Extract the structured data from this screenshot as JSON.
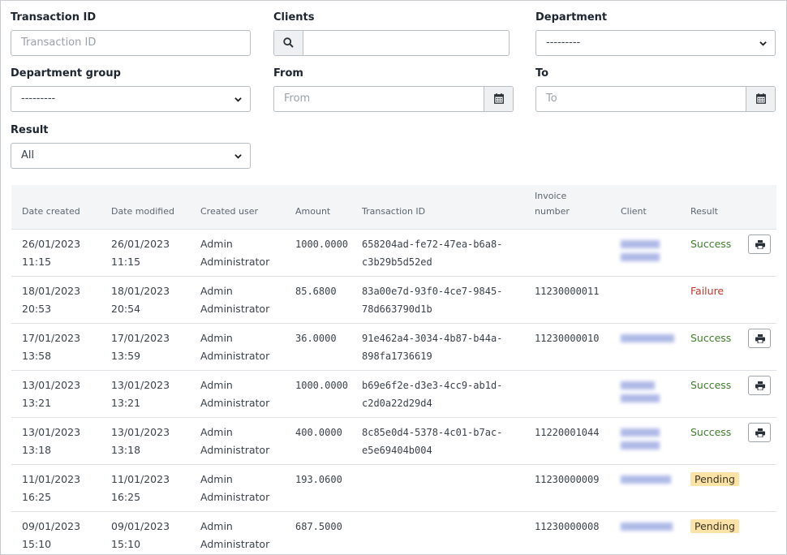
{
  "filters": {
    "transaction_id": {
      "label": "Transaction ID",
      "placeholder": "Transaction ID"
    },
    "clients": {
      "label": "Clients",
      "value": ""
    },
    "department": {
      "label": "Department",
      "selected": "---------"
    },
    "department_group": {
      "label": "Department group",
      "selected": "---------"
    },
    "from": {
      "label": "From",
      "placeholder": "From"
    },
    "to": {
      "label": "To",
      "placeholder": "To"
    },
    "result": {
      "label": "Result",
      "selected": "All"
    }
  },
  "table": {
    "headers": [
      "Date created",
      "Date modified",
      "Created user",
      "Amount",
      "Transaction ID",
      "Invoice number",
      "Client",
      "Result",
      ""
    ],
    "rows": [
      {
        "created_date": "26/01/2023",
        "created_time": "11:15",
        "modified_date": "26/01/2023",
        "modified_time": "11:15",
        "user_first": "Admin",
        "user_last": "Administrator",
        "amount": "1000.0000",
        "txn1": "658204ad-fe72-47ea-b6a8-",
        "txn2": "c3b29b5d52ed",
        "invoice": "",
        "result": "Success",
        "result_type": "success",
        "printable": true
      },
      {
        "created_date": "18/01/2023",
        "created_time": "20:53",
        "modified_date": "18/01/2023",
        "modified_time": "20:54",
        "user_first": "Admin",
        "user_last": "Administrator",
        "amount": "85.6800",
        "txn1": "83a00e7d-93f0-4ce7-9845-",
        "txn2": "78d663790d1b",
        "invoice": "11230000011",
        "result": "Failure",
        "result_type": "failure",
        "printable": false
      },
      {
        "created_date": "17/01/2023",
        "created_time": "13:58",
        "modified_date": "17/01/2023",
        "modified_time": "13:59",
        "user_first": "Admin",
        "user_last": "Administrator",
        "amount": "36.0000",
        "txn1": "91e462a4-3034-4b87-b44a-",
        "txn2": "898fa1736619",
        "invoice": "11230000010",
        "result": "Success",
        "result_type": "success",
        "printable": true
      },
      {
        "created_date": "13/01/2023",
        "created_time": "13:21",
        "modified_date": "13/01/2023",
        "modified_time": "13:21",
        "user_first": "Admin",
        "user_last": "Administrator",
        "amount": "1000.0000",
        "txn1": "b69e6f2e-d3e3-4cc9-ab1d-",
        "txn2": "c2d0a22d29d4",
        "invoice": "",
        "result": "Success",
        "result_type": "success",
        "printable": true
      },
      {
        "created_date": "13/01/2023",
        "created_time": "13:18",
        "modified_date": "13/01/2023",
        "modified_time": "13:18",
        "user_first": "Admin",
        "user_last": "Administrator",
        "amount": "400.0000",
        "txn1": "8c85e0d4-5378-4c01-b7ac-",
        "txn2": "e5e69404b004",
        "invoice": "11220001044",
        "result": "Success",
        "result_type": "success",
        "printable": true
      },
      {
        "created_date": "11/01/2023",
        "created_time": "16:25",
        "modified_date": "11/01/2023",
        "modified_time": "16:25",
        "user_first": "Admin",
        "user_last": "Administrator",
        "amount": "193.0600",
        "txn1": "",
        "txn2": "",
        "invoice": "11230000009",
        "result": "Pending",
        "result_type": "pending",
        "printable": false
      },
      {
        "created_date": "09/01/2023",
        "created_time": "15:10",
        "modified_date": "09/01/2023",
        "modified_time": "15:10",
        "user_first": "Admin",
        "user_last": "Administrator",
        "amount": "687.5000",
        "txn1": "",
        "txn2": "",
        "invoice": "11230000008",
        "result": "Pending",
        "result_type": "pending",
        "printable": false
      }
    ]
  },
  "colors": {
    "success": "#3e7f2c",
    "failure": "#c0392b",
    "pending_bg": "#fbe3a8",
    "redacted": "#aeb9e6"
  },
  "icons": {
    "search": "search-icon",
    "calendar": "calendar-icon",
    "print": "print-icon",
    "caret": "chevron-down-icon"
  }
}
